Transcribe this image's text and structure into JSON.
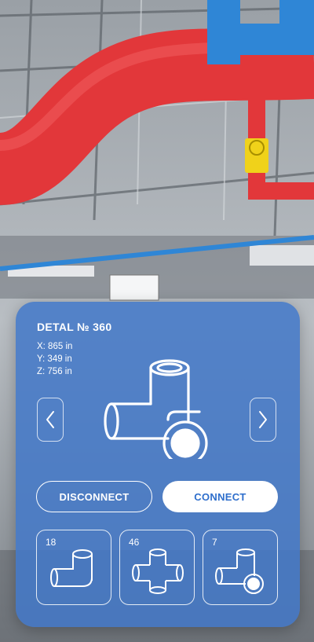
{
  "part": {
    "title": "DETAL № 360",
    "coords": {
      "x": "X: 865 in",
      "y": "Y: 349 in",
      "z": "Z: 756 in"
    }
  },
  "actions": {
    "disconnect_label": "DISCONNECT",
    "connect_label": "CONNECT"
  },
  "nav": {
    "prev_icon": "chevron-left-icon",
    "next_icon": "chevron-right-icon"
  },
  "library": [
    {
      "count": "18",
      "icon": "elbow-fitting-icon"
    },
    {
      "count": "46",
      "icon": "cross-fitting-icon"
    },
    {
      "count": "7",
      "icon": "tee-fitting-icon"
    }
  ],
  "colors": {
    "panel": "#4278c8",
    "accent_text": "#2f6fcc",
    "pipe_red": "#e2373a",
    "pipe_blue": "#2f86d6"
  }
}
